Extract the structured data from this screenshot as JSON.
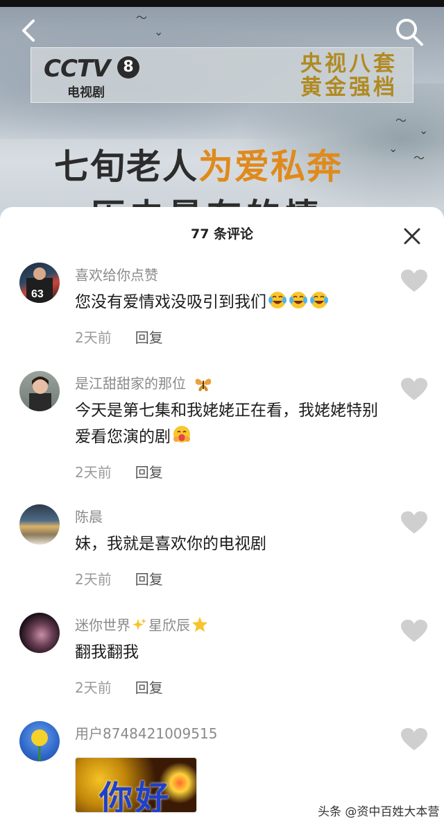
{
  "video": {
    "logo_main": "CCTV",
    "logo_number": "8",
    "logo_sub": "电视剧",
    "slogan_line1": "央视八套",
    "slogan_line2": "黄金强档",
    "headline_part1": "七旬老人",
    "headline_highlight": "为爱私奔",
    "headline_line2": "历史最有的情"
  },
  "panel": {
    "title": "77 条评论"
  },
  "comments": [
    {
      "username": "喜欢给你点赞",
      "text": "您没有爱情戏没吸引到我们",
      "emojis": [
        "laugh-cry-emoji",
        "laugh-cry-emoji",
        "laugh-cry-emoji"
      ],
      "time": "2天前",
      "reply": "回复"
    },
    {
      "username": "是江甜甜家的那位",
      "username_emoji": "butterfly-emoji",
      "text": "今天是第七集和我姥姥正在看，我姥姥特别爱看您演的剧",
      "emojis": [
        "hug-emoji"
      ],
      "time": "2天前",
      "reply": "回复"
    },
    {
      "username": "陈晨",
      "text": "妹，我就是喜欢你的电视剧",
      "time": "2天前",
      "reply": "回复"
    },
    {
      "username_part1": "迷你世界",
      "username_part2": "星欣辰",
      "username_emojis": [
        "sparkles-emoji",
        "star-emoji"
      ],
      "text": "翻我翻我",
      "time": "2天前",
      "reply": "回复"
    },
    {
      "username": "用户8748421009515",
      "sticker_text": "你好"
    }
  ],
  "watermark": "头条 @资中百姓大本营",
  "colors": {
    "highlight_orange": "#e08a1c",
    "slogan_gold": "#b08a22",
    "username_gray": "#8a8a8a",
    "heart_gray": "#cfcfcf"
  }
}
